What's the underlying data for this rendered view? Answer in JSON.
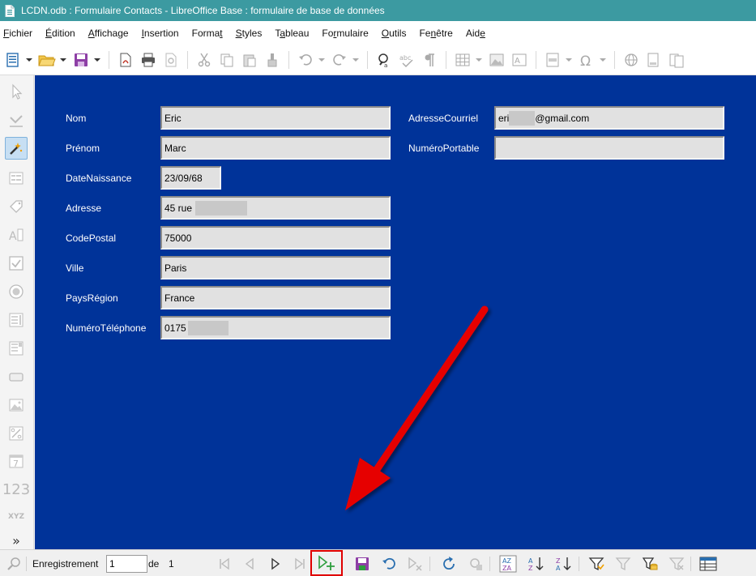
{
  "window": {
    "title": "LCDN.odb : Formulaire Contacts - LibreOffice Base : formulaire de base de données"
  },
  "menu": {
    "items": [
      {
        "pre": "",
        "ul": "F",
        "post": "ichier"
      },
      {
        "pre": "",
        "ul": "É",
        "post": "dition"
      },
      {
        "pre": "",
        "ul": "A",
        "post": "ffichage"
      },
      {
        "pre": "",
        "ul": "I",
        "post": "nsertion"
      },
      {
        "pre": "Forma",
        "ul": "t",
        "post": ""
      },
      {
        "pre": "",
        "ul": "S",
        "post": "tyles"
      },
      {
        "pre": "T",
        "ul": "a",
        "post": "bleau"
      },
      {
        "pre": "Fo",
        "ul": "r",
        "post": "mulaire"
      },
      {
        "pre": "",
        "ul": "O",
        "post": "utils"
      },
      {
        "pre": "Fe",
        "ul": "n",
        "post": "être"
      },
      {
        "pre": "Aid",
        "ul": "e",
        "post": ""
      }
    ]
  },
  "form": {
    "fields": {
      "nom": {
        "label": "Nom",
        "value": "Eric"
      },
      "prenom": {
        "label": "Prénom",
        "value": "Marc"
      },
      "datenaissance": {
        "label": "DateNaissance",
        "value": "23/09/68"
      },
      "adresse": {
        "label": "Adresse",
        "value": "45 rue"
      },
      "codepostal": {
        "label": "CodePostal",
        "value": "75000"
      },
      "ville": {
        "label": "Ville",
        "value": "Paris"
      },
      "paysregion": {
        "label": "PaysRégion",
        "value": "France"
      },
      "telephone": {
        "label": "NuméroTéléphone",
        "value": "0175"
      },
      "courriel": {
        "label": "AdresseCourriel",
        "value_prefix": "eri",
        "value_suffix": "@gmail.com"
      },
      "portable": {
        "label": "NuméroPortable",
        "value": ""
      }
    }
  },
  "navigation": {
    "record_label": "Enregistrement",
    "record_value": "1",
    "of_label": "de",
    "total": "1"
  },
  "colors": {
    "titlebar": "#3c9aa1",
    "form_background": "#003399",
    "field_background": "#e1e1e1",
    "highlight": "#e00000",
    "arrow": "#e60000"
  },
  "sidebar": {
    "numeric_field_glyph": "123",
    "formatted_field_glyph": "XYZ",
    "more_glyph": "»"
  }
}
